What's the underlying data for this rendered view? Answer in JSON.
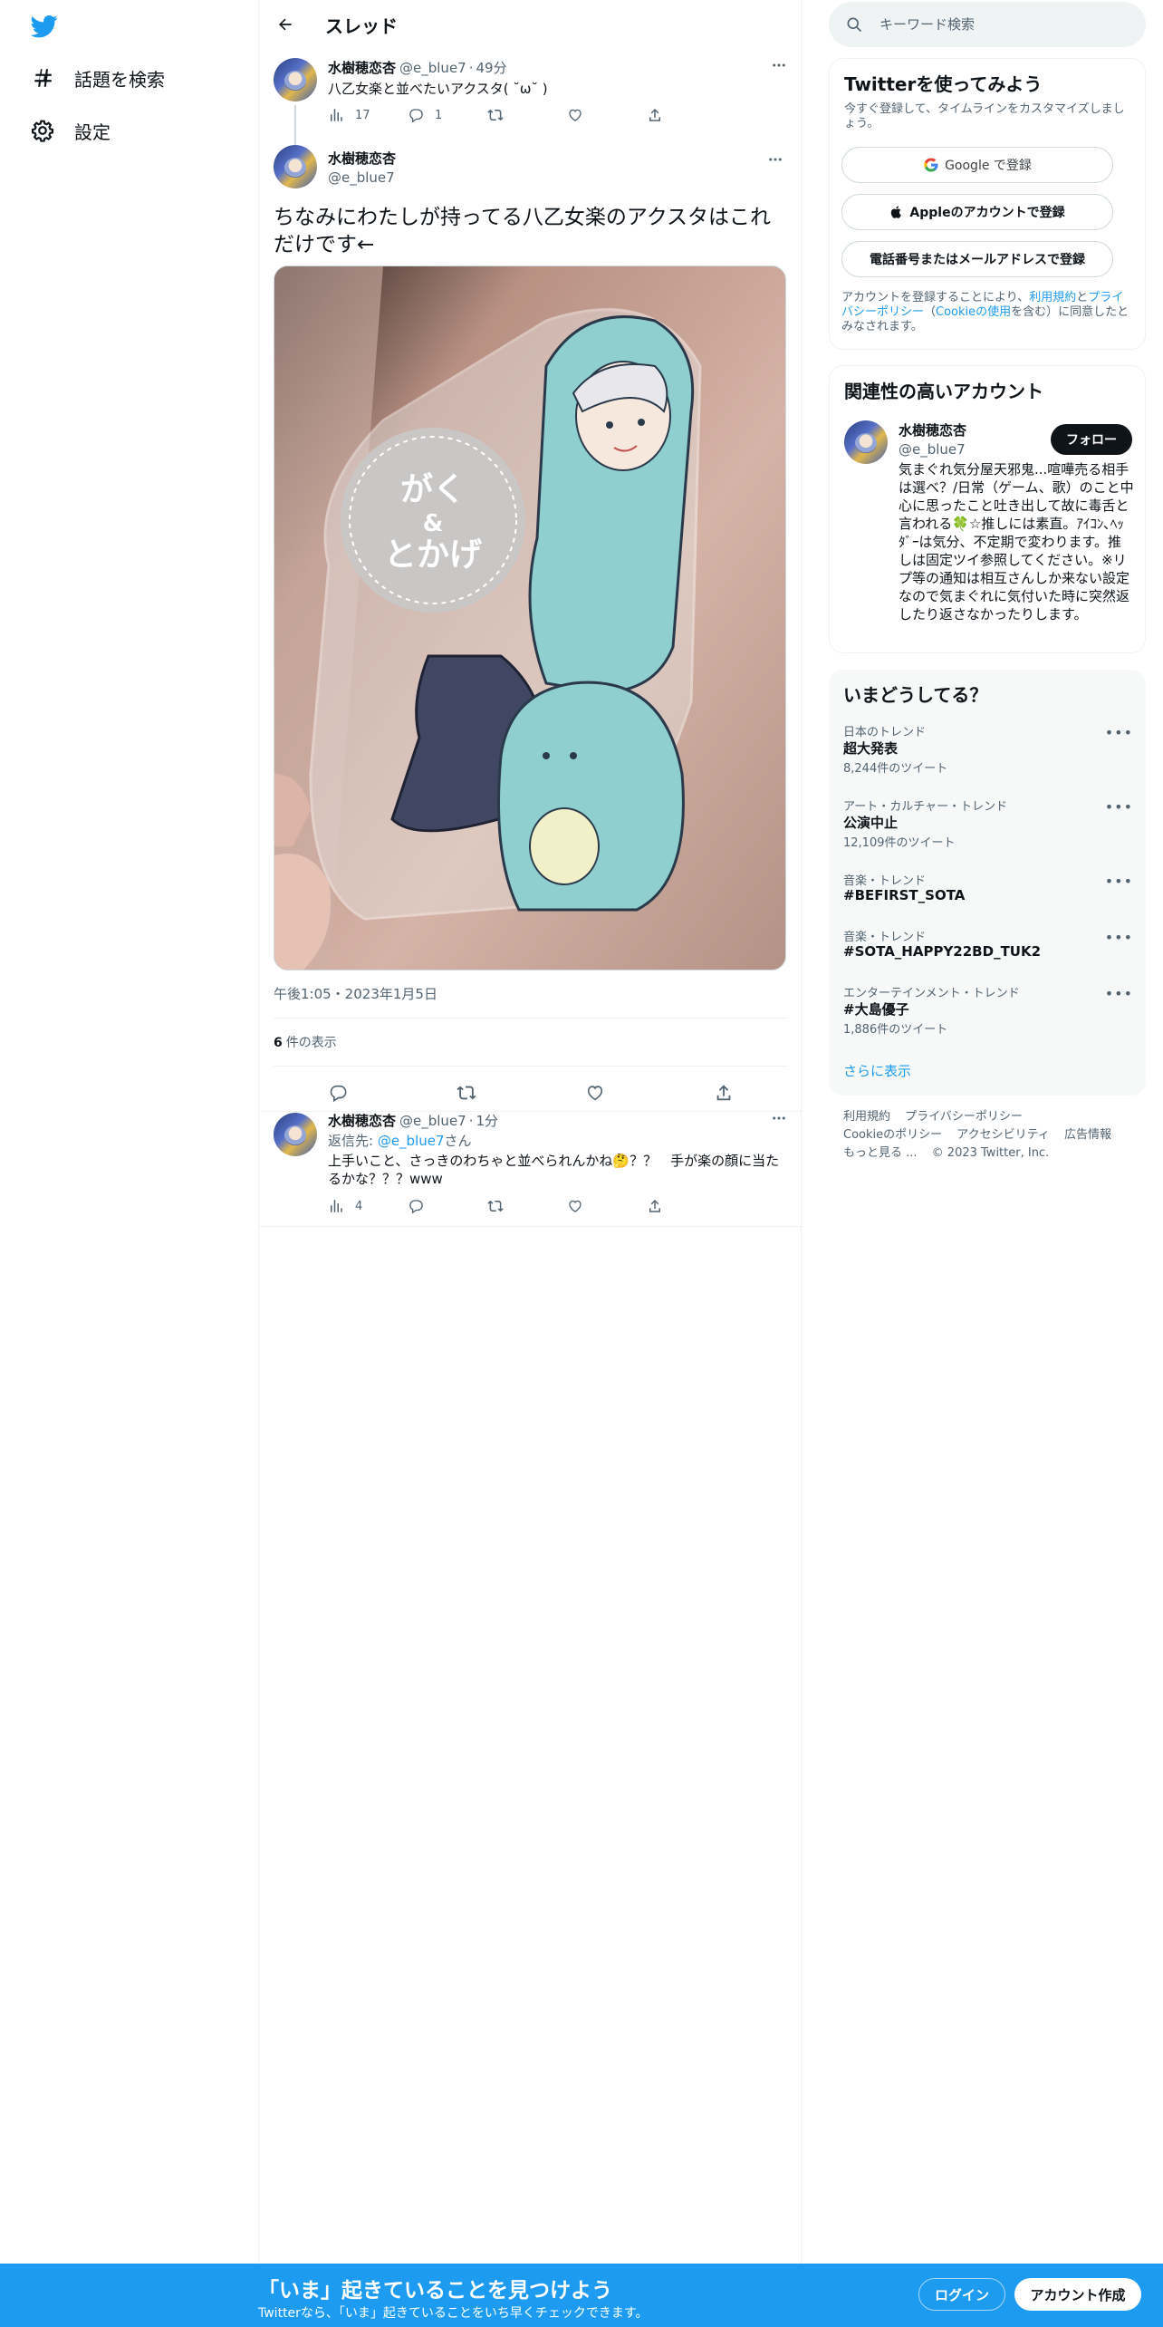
{
  "nav": {
    "explore_label": "話題を検索",
    "settings_label": "設定"
  },
  "header": {
    "title": "スレッド"
  },
  "parent_tweet": {
    "name": "水樹穂恋杏",
    "handle": "@e_blue7",
    "time": "49分",
    "text": "八乙女楽と並べたいアクスタ( ˘ω˘ )",
    "views": "17",
    "replies": "1",
    "retweets": "",
    "likes": ""
  },
  "main_tweet": {
    "name": "水樹穂恋杏",
    "handle": "@e_blue7",
    "text": "ちなみにわたしが持ってる八乙女楽のアクスタはこれだけです←",
    "photo_text_1": "がく",
    "photo_text_2": "&",
    "photo_text_3": "とかげ",
    "timestamp": "午後1:05・2023年1月5日",
    "views_count": "6",
    "views_label": "件の表示"
  },
  "reply_tweet": {
    "name": "水樹穂恋杏",
    "handle": "@e_blue7",
    "time": "1分",
    "reply_prefix": "返信先: ",
    "reply_handle": "@e_blue7",
    "reply_suffix": "さん",
    "text": "上手いこと、さっきのわちゃと並べられんかね🤔？？　手が楽の顔に当たるかな？？？www",
    "views": "4"
  },
  "search": {
    "placeholder": "キーワード検索"
  },
  "signup_panel": {
    "title": "Twitterを使ってみよう",
    "subtitle": "今すぐ登録して、タイムラインをカスタマイズしましょう。",
    "google_label": "Google で登録",
    "apple_label": "Appleのアカウントで登録",
    "phone_label": "電話番号またはメールアドレスで登録",
    "legal_1": "アカウントを登録することにより、",
    "legal_terms": "利用規約",
    "legal_2": "と",
    "legal_privacy": "プライバシーポリシー",
    "legal_3": "（",
    "legal_cookie": "Cookieの使用",
    "legal_4": "を含む）に同意したとみなされます。"
  },
  "relevant_panel": {
    "title": "関連性の高いアカウント",
    "name": "水樹穂恋杏",
    "handle": "@e_blue7",
    "follow_label": "フォロー",
    "bio": "気まぐれ気分屋天邪鬼...喧嘩売る相手は選べ？/日常（ゲーム、歌）のこと中心に思ったこと吐き出して故に毒舌と言われる🍀☆推しには素直。ｱｲｺﾝ､ﾍｯﾀﾞｰは気分、不定期で変わります。推しは固定ツイ参照してください。※リプ等の通知は相互さんしか来ない設定なので気まぐれに気付いた時に突然返したり返さなかったりします。"
  },
  "trends_panel": {
    "title": "いまどうしてる？",
    "items": [
      {
        "category": "日本のトレンド",
        "name": "超大発表",
        "count": "8,244件のツイート"
      },
      {
        "category": "アート・カルチャー・トレンド",
        "name": "公演中止",
        "count": "12,109件のツイート"
      },
      {
        "category": "音楽・トレンド",
        "name": "#BEFIRST_SOTA",
        "count": ""
      },
      {
        "category": "音楽・トレンド",
        "name": "#SOTA_HAPPY22BD_TUK2",
        "count": ""
      },
      {
        "category": "エンターテインメント・トレンド",
        "name": "#大島優子",
        "count": "1,886件のツイート"
      }
    ],
    "show_more": "さらに表示"
  },
  "footer": {
    "terms": "利用規約",
    "privacy": "プライバシーポリシー",
    "cookie": "Cookieのポリシー",
    "accessibility": "アクセシビリティ",
    "ads": "広告情報",
    "more": "もっと見る ...",
    "copyright": "© 2023 Twitter, Inc."
  },
  "bottom_bar": {
    "title": "「いま」起きていることを見つけよう",
    "subtitle": "Twitterなら、「いま」起きていることをいち早くチェックできます。",
    "login_label": "ログイン",
    "signup_label": "アカウント作成"
  },
  "colors": {
    "brand_blue": "#1d9bf0",
    "text": "#0f1419",
    "muted": "#536471"
  }
}
